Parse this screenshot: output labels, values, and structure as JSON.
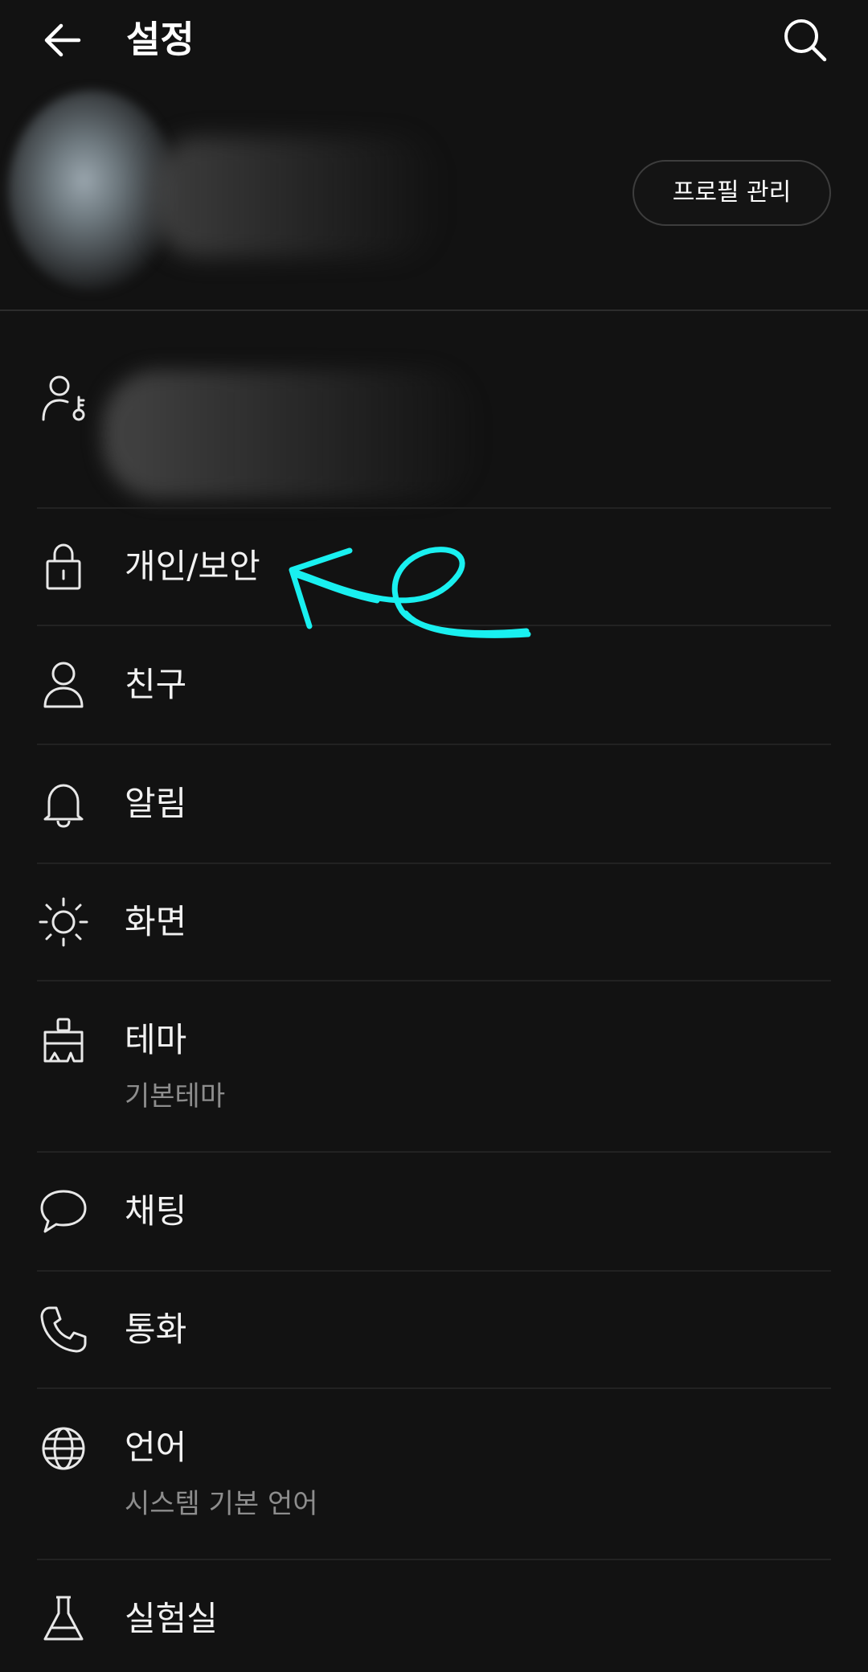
{
  "header": {
    "title": "설정",
    "back_icon": "arrow-left-icon",
    "search_icon": "search-icon"
  },
  "profile": {
    "manage_button_label": "프로필 관리"
  },
  "menu": {
    "privacy": {
      "label": "개인/보안",
      "icon": "lock-icon"
    },
    "friends": {
      "label": "친구",
      "icon": "person-icon"
    },
    "notifications": {
      "label": "알림",
      "icon": "bell-icon"
    },
    "display": {
      "label": "화면",
      "icon": "brightness-icon"
    },
    "theme": {
      "label": "테마",
      "sub": "기본테마",
      "icon": "paint-brush-icon"
    },
    "chat": {
      "label": "채팅",
      "icon": "chat-bubble-icon"
    },
    "call": {
      "label": "통화",
      "icon": "phone-icon"
    },
    "language": {
      "label": "언어",
      "sub": "시스템 기본 언어",
      "icon": "globe-icon"
    },
    "lab": {
      "label": "실험실",
      "icon": "flask-icon"
    }
  },
  "colors": {
    "background": "#121212",
    "text": "#ffffff",
    "subtext": "#8d8d8d",
    "annotation": "#19f0f0"
  }
}
